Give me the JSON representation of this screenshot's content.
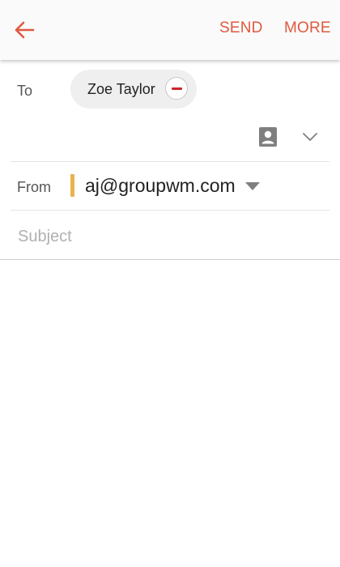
{
  "colors": {
    "accent": "#e0593f",
    "remove_red": "#d0232c",
    "account_yellow": "#e9b34f",
    "icon_gray": "#7f7f7f"
  },
  "toolbar": {
    "back_icon": "arrow-left-icon",
    "send_label": "SEND",
    "more_label": "MORE"
  },
  "recipients": {
    "to_label": "To",
    "chips": [
      {
        "name": "Zoe Taylor",
        "remove_icon": "minus-circle-icon"
      }
    ],
    "contacts_icon": "contact-card-icon",
    "expand_icon": "chevron-down-icon"
  },
  "from": {
    "label": "From",
    "email": "aj@groupwm.com",
    "dropdown_icon": "triangle-down-icon"
  },
  "subject": {
    "value": "",
    "placeholder": "Subject"
  },
  "body": {
    "value": ""
  }
}
